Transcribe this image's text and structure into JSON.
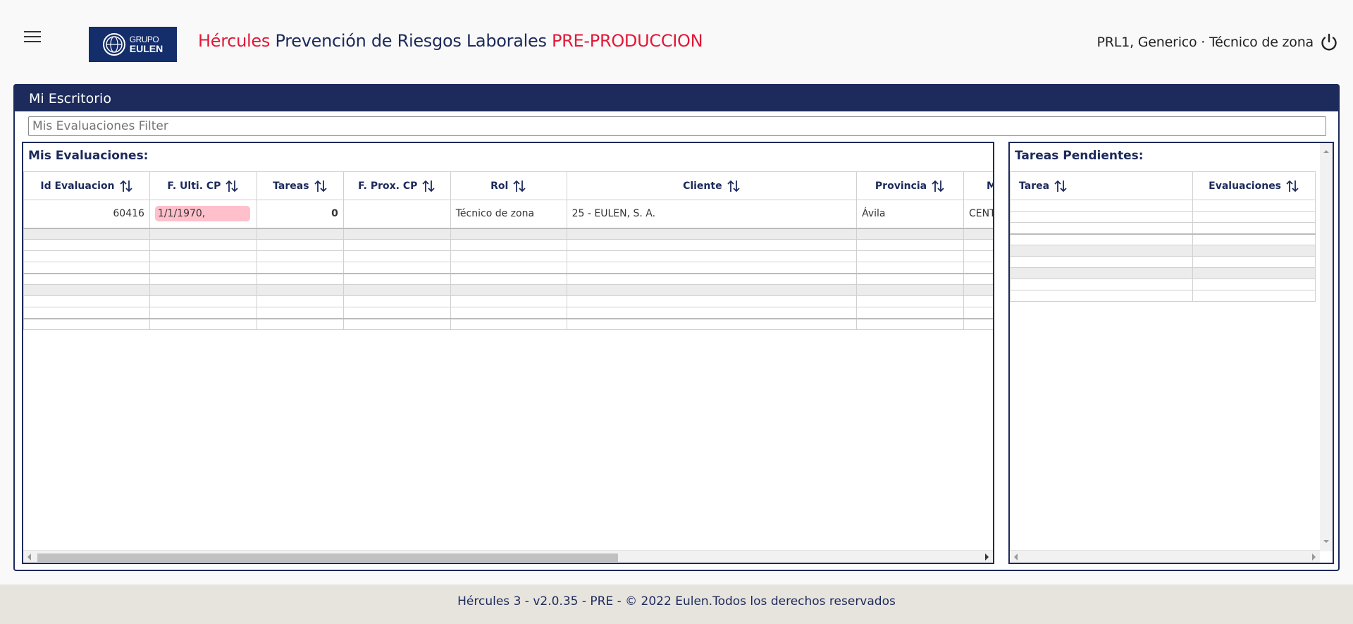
{
  "header": {
    "title_part1": "Hércules",
    "title_part2": " Prevención de Riesgos Laborales ",
    "title_part3": "PRE-PRODUCCION",
    "user_info": "PRL1, Generico  ·  Técnico de zona",
    "logo_line1": "GRUPO",
    "logo_line2": "EULEN"
  },
  "panel": {
    "title": "Mi Escritorio",
    "filter_placeholder": "Mis Evaluaciones Filter"
  },
  "evaluaciones": {
    "title": "Mis Evaluaciones:",
    "columns": [
      "Id Evaluacion",
      "F. Ulti. CP",
      "Tareas",
      "F. Prox. CP",
      "Rol",
      "Cliente",
      "Provincia",
      "M"
    ],
    "rows": [
      {
        "id": "60416",
        "f_ulti": "1/1/1970,",
        "tareas": "0",
        "f_prox": "",
        "rol": "Técnico de zona",
        "cliente": "25 - EULEN, S. A.",
        "provincia": "Ávila",
        "m": "CENT"
      }
    ]
  },
  "tareas": {
    "title": "Tareas Pendientes:",
    "columns": [
      "Tarea",
      "Evaluaciones"
    ]
  },
  "footer": {
    "text": "Hércules 3 - v2.0.35 - PRE - © 2022 Eulen.Todos los derechos reservados"
  },
  "colors": {
    "navy": "#1c2a5c",
    "accent_red": "#e31837",
    "date_pill": "#ffc0cb"
  }
}
